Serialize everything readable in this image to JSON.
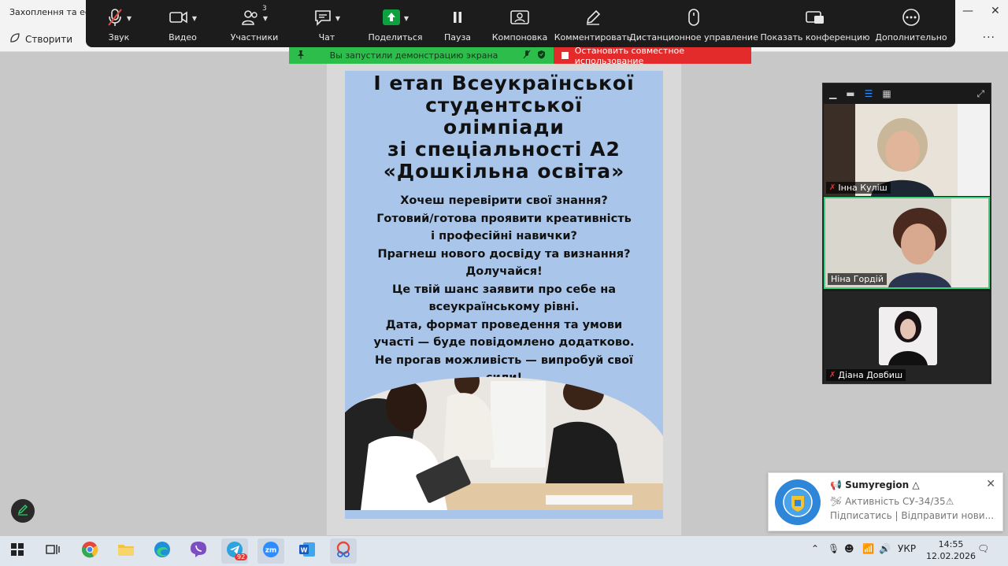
{
  "background_app": {
    "title": "Захоплення та ескі",
    "create_label": "Створити"
  },
  "toolbar": {
    "sound_label": "Звук",
    "video_label": "Видео",
    "participants_label": "Участники",
    "participants_count": "3",
    "chat_label": "Чат",
    "share_label": "Поделиться",
    "pause_label": "Пауза",
    "layout_label": "Компоновка",
    "comment_label": "Комментировать",
    "remote_label": "Дистанционное управление",
    "show_conf_label": "Показать конференцию",
    "more_label": "Дополнительно"
  },
  "share_banner": {
    "text": "Вы запустили демонстрацию экрана",
    "stop_label": "Остановить совместное использование"
  },
  "slide": {
    "title_lines": [
      "І етап Всеукраїнської",
      "студентської",
      "олімпіади",
      " зі спеціальності А2",
      "«Дошкільна освіта»"
    ],
    "body_lines": [
      "Хочеш перевірити свої знання?",
      "Готовий/готова проявити креативність",
      "і професійні навички?",
      "Прагнеш нового досвіду та визнання?",
      "Долучайся!",
      "Це твій шанс заявити про себе на",
      "всеукраїнському рівні.",
      "Дата, формат проведення та умови",
      "участі — буде повідомлено додатково.",
      "Не прогав можливість — випробуй свої",
      "сили!"
    ]
  },
  "participants": [
    {
      "name": "Інна Куліш",
      "muted": true
    },
    {
      "name": "Ніна Гордій",
      "muted": false
    },
    {
      "name": "Діана Довбиш",
      "muted": true
    }
  ],
  "notification": {
    "title": "Sumyregion",
    "line1": "Активність СУ-34/35",
    "line2": "Підписатись | Відправити нови..."
  },
  "taskbar": {
    "telegram_badge": "92",
    "language": "УКР",
    "time": "14:55",
    "date": "12.02.2026"
  },
  "colors": {
    "toolbar_bg": "#1c1c1c",
    "share_green": "#2dbd4b",
    "stop_red": "#e42b2b",
    "slide_blue": "#a9c6ea",
    "speaking_border": "#37d47f"
  }
}
